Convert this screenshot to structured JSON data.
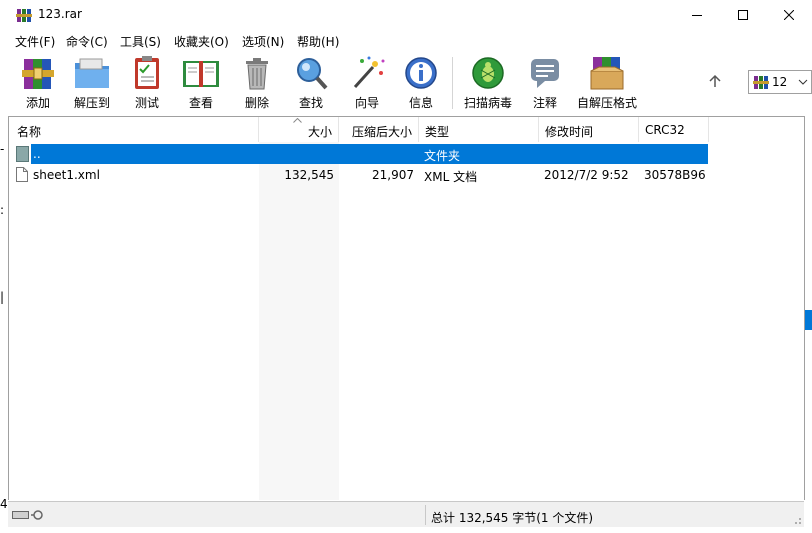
{
  "window": {
    "title": "123.rar"
  },
  "menu": {
    "items": [
      "文件(F)",
      "命令(C)",
      "工具(S)",
      "收藏夹(O)",
      "选项(N)",
      "帮助(H)"
    ]
  },
  "toolbar": {
    "buttons": [
      "添加",
      "解压到",
      "测试",
      "查看",
      "删除",
      "查找",
      "向导",
      "信息",
      "扫描病毒",
      "注释",
      "自解压格式"
    ],
    "address_text": "12"
  },
  "list": {
    "columns": [
      "名称",
      "大小",
      "压缩后大小",
      "类型",
      "修改时间",
      "CRC32"
    ],
    "rows": [
      {
        "name": "..",
        "size": "",
        "packed": "",
        "type": "文件夹",
        "modified": "",
        "crc": ""
      },
      {
        "name": "sheet1.xml",
        "size": "132,545",
        "packed": "21,907",
        "type": "XML 文档",
        "modified": "2012/7/2 9:52",
        "crc": "30578B96"
      }
    ]
  },
  "status": {
    "summary": "总计 132,545 字节(1 个文件)"
  },
  "colors": {
    "selection": "#0078d7",
    "sorted_column": "#f7f7f7"
  }
}
